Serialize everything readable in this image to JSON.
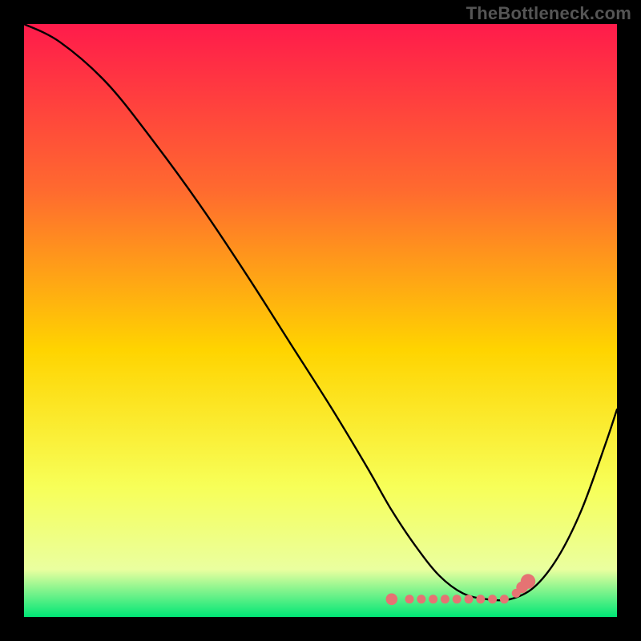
{
  "watermark": "TheBottleneck.com",
  "gradient": {
    "top": "#ff1b4b",
    "q1": "#ff6a2f",
    "mid": "#ffd400",
    "q3": "#f7ff58",
    "low": "#eaff9f",
    "bottom": "#00e676"
  },
  "chart_data": {
    "type": "line",
    "title": "",
    "xlabel": "",
    "ylabel": "",
    "xlim": [
      0,
      100
    ],
    "ylim": [
      0,
      100
    ],
    "series": [
      {
        "name": "bottleneck-curve",
        "x": [
          0,
          6,
          14,
          22,
          30,
          38,
          45,
          52,
          58,
          62,
          66,
          70,
          74,
          78,
          82,
          86,
          90,
          94,
          98,
          100
        ],
        "values": [
          100,
          97,
          90,
          80,
          69,
          57,
          46,
          35,
          25,
          18,
          12,
          7,
          4,
          3,
          3,
          5,
          10,
          18,
          29,
          35
        ]
      }
    ],
    "markers": {
      "name": "bottleneck-region-dots",
      "x": [
        62,
        65,
        67,
        69,
        71,
        73,
        75,
        77,
        79,
        81,
        83,
        84,
        85
      ],
      "values": [
        3,
        3,
        3,
        3,
        3,
        3,
        3,
        3,
        3,
        3,
        4,
        5,
        6
      ],
      "color": "#e57373",
      "radius_index": [
        4,
        3,
        3,
        3,
        3,
        3,
        3,
        3,
        3,
        3,
        3,
        4,
        5
      ]
    }
  }
}
